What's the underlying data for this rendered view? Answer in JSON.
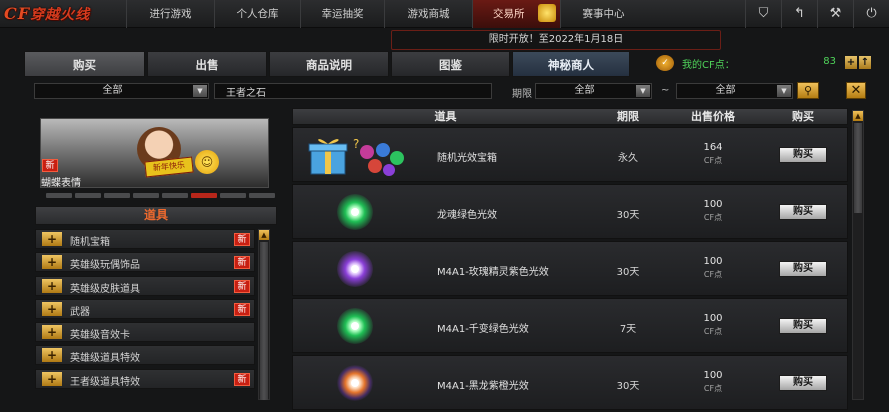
{
  "app": {
    "logo_prefix": "CF",
    "logo_text": "穿越火线"
  },
  "nav": [
    {
      "label": "进行游戏"
    },
    {
      "label": "个人仓库"
    },
    {
      "label": "幸运抽奖"
    },
    {
      "label": "游戏商城"
    },
    {
      "label": "交易所",
      "active": true
    },
    {
      "label": "赛事中心"
    }
  ],
  "top_icons": [
    "shield-icon",
    "back-icon",
    "wrench-icon",
    "power-icon"
  ],
  "notice": "限时开放！至2022年1月18日",
  "tabs": [
    {
      "label": "购买",
      "active": true
    },
    {
      "label": "出售"
    },
    {
      "label": "商品说明"
    },
    {
      "label": "图鉴"
    },
    {
      "label": "神秘商人"
    }
  ],
  "cf": {
    "label": "我的CF点：",
    "value": "83"
  },
  "filters": {
    "category": "全部",
    "keyword": "王者之石",
    "period_label": "期限",
    "period": "全部",
    "tilde": "~",
    "period_end": "全部"
  },
  "promo": {
    "new_badge": "新",
    "sign_text": "新年快乐",
    "name": "蝴蝶表情"
  },
  "carousel": {
    "count": 8,
    "active_index": 5
  },
  "category_header": "道具",
  "categories": [
    {
      "name": "随机宝箱",
      "is_new": true
    },
    {
      "name": "英雄级玩偶饰品",
      "is_new": true
    },
    {
      "name": "英雄级皮肤道具",
      "is_new": true
    },
    {
      "name": "武器",
      "is_new": true
    },
    {
      "name": "英雄级音效卡",
      "is_new": false
    },
    {
      "name": "英雄级道具特效",
      "is_new": false
    },
    {
      "name": "王者级道具特效",
      "is_new": true
    }
  ],
  "new_tag": "新",
  "table": {
    "headers": {
      "item": "道具",
      "period": "期限",
      "price": "出售价格",
      "buy": "购买"
    },
    "rows": [
      {
        "name": "随机光效宝箱",
        "period": "永久",
        "price": "164",
        "unit": "CF点",
        "button": "购买",
        "color": "#d63d8e",
        "icon": "gift-box-icon"
      },
      {
        "name": "龙魂绿色光效",
        "period": "30天",
        "price": "100",
        "unit": "CF点",
        "button": "购买",
        "color": "#1fbf55",
        "icon": "green-glow-icon"
      },
      {
        "name": "M4A1-玫瑰精灵紫色光效",
        "period": "30天",
        "price": "100",
        "unit": "CF点",
        "button": "购买",
        "color": "#8a3fd8",
        "icon": "purple-glow-icon"
      },
      {
        "name": "M4A1-千变绿色光效",
        "period": "7天",
        "price": "100",
        "unit": "CF点",
        "button": "购买",
        "color": "#1fbf55",
        "icon": "green-glow-icon"
      },
      {
        "name": "M4A1-黑龙紫橙光效",
        "period": "30天",
        "price": "100",
        "unit": "CF点",
        "button": "购买",
        "color": "#e4732a",
        "icon": "orange-glow-icon"
      }
    ]
  }
}
